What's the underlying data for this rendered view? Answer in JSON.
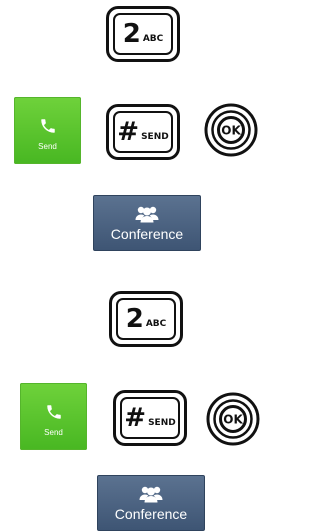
{
  "groups": [
    {
      "key2": {
        "digit": "2",
        "letters": "ABC"
      },
      "send_key": {
        "label": "Send"
      },
      "hash_key": {
        "symbol": "#",
        "label": "SEND"
      },
      "ok_button": {
        "label": "OK"
      },
      "conference": {
        "label": "Conference"
      }
    },
    {
      "key2": {
        "digit": "2",
        "letters": "ABC"
      },
      "send_key": {
        "label": "Send"
      },
      "hash_key": {
        "symbol": "#",
        "label": "SEND"
      },
      "ok_button": {
        "label": "OK"
      },
      "conference": {
        "label": "Conference"
      }
    }
  ],
  "colors": {
    "send_green": "#52bf2a",
    "conference_blue": "#4a6180",
    "key_outline": "#111111"
  },
  "icons": {
    "send": "phone-icon",
    "conference": "people-icon"
  }
}
